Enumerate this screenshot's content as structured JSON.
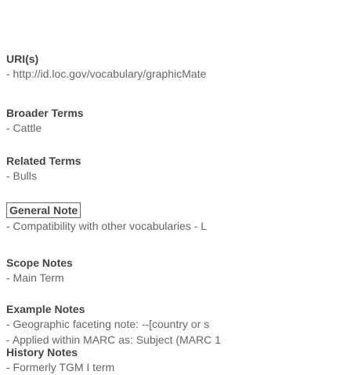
{
  "top_cut_text": "",
  "sections": {
    "uris": {
      "heading": "URI(s)",
      "lines": [
        "- http://id.loc.gov/vocabulary/graphicMate"
      ]
    },
    "broader_terms": {
      "heading": "Broader Terms",
      "lines": [
        "- Cattle"
      ]
    },
    "related_terms": {
      "heading": "Related Terms",
      "lines": [
        "- Bulls"
      ]
    },
    "general_note": {
      "heading": "General Note",
      "lines": [
        "- Compatibility with other vocabularies - L"
      ]
    },
    "scope_notes": {
      "heading": "Scope Notes",
      "lines": [
        "- Main Term"
      ]
    },
    "example_notes": {
      "heading": "Example Notes",
      "lines": [
        "- Geographic faceting note: --[country or s",
        "- Applied within MARC as: Subject (MARC 1"
      ]
    },
    "history_notes": {
      "heading": "History Notes",
      "lines": [
        "- Formerly TGM I term"
      ]
    }
  }
}
